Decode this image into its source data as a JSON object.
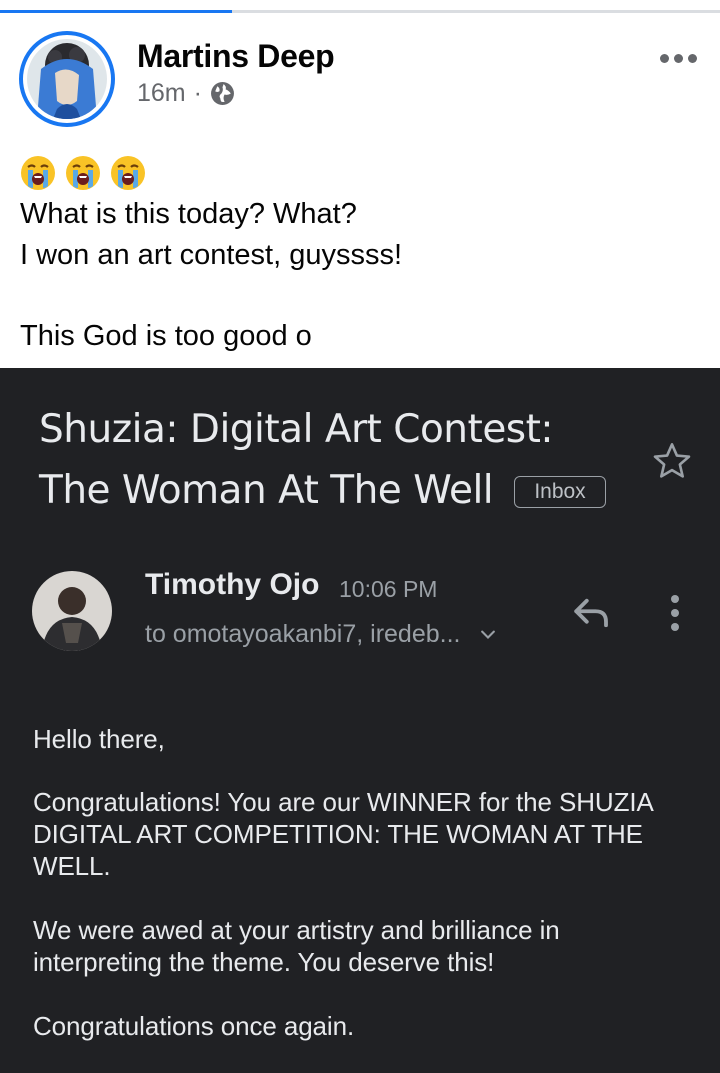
{
  "post": {
    "author_name": "Martins Deep",
    "time_ago": "16m",
    "separator": "·",
    "privacy_icon": "globe-icon",
    "emojis": [
      "loudly-crying-face",
      "loudly-crying-face",
      "loudly-crying-face"
    ],
    "lines": [
      "What is this today? What?",
      "I won an art contest, guyssss!",
      "This God is too good o"
    ]
  },
  "email": {
    "subject_line_1": "Shuzia: Digital Art Contest:",
    "subject_line_2": "The Woman At The Well",
    "label": "Inbox",
    "sender_name": "Timothy Ojo",
    "time": "10:06 PM",
    "recipients": "to omotayoakanbi7, iredeb...",
    "body": {
      "greeting": "Hello there,",
      "para1_line1": "Congratulations! You are our WINNER for the SHUZIA",
      "para1_line2": "DIGITAL ART COMPETITION: THE WOMAN AT THE",
      "para1_line3": "WELL.",
      "para2_line1": "We were awed at your artistry and brilliance in",
      "para2_line2": "interpreting the theme. You deserve this!",
      "closing": "Congratulations once again."
    }
  },
  "colors": {
    "facebook_blue": "#1877f2",
    "email_background": "#202124",
    "email_text": "#e8eaed",
    "email_secondary": "#9aa0a6"
  }
}
